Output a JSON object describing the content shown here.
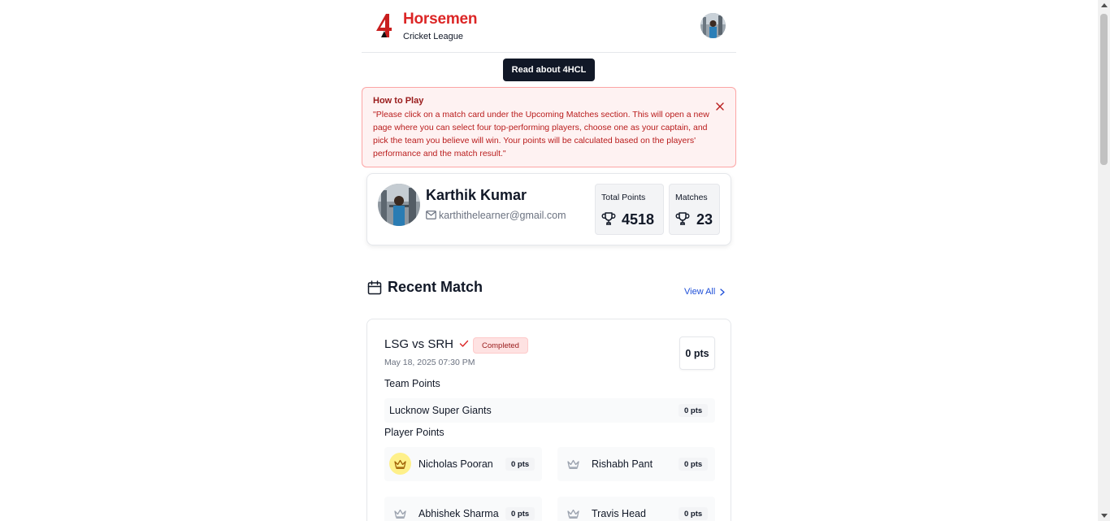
{
  "header": {
    "brand_title": "Horsemen",
    "brand_subtitle": "Cricket League",
    "logo_icon": "4-logo-icon",
    "avatar_icon": "user-avatar-icon"
  },
  "read_button": {
    "label": "Read about 4HCL"
  },
  "alert": {
    "title": "How to Play",
    "body": "\"Please click on a match card under the Upcoming Matches section. This will open a new page where you can select four top-performing players, choose one as your captain, and pick the team you believe will win. Your points will be calculated based on the players' performance and the match result.\"",
    "close_icon": "close-icon"
  },
  "profile": {
    "name": "Karthik Kumar",
    "email": "karthithelearner@gmail.com",
    "stats": [
      {
        "label": "Total Points",
        "value": "4518",
        "icon": "trophy-icon"
      },
      {
        "label": "Matches",
        "value": "23",
        "icon": "trophy-icon"
      }
    ]
  },
  "recent": {
    "title": "Recent Match",
    "view_all": "View All"
  },
  "match": {
    "title": "LSG vs SRH",
    "status": "Completed",
    "date": "May 18, 2025 07:30 PM",
    "points": "0 pts",
    "team_points_label": "Team Points",
    "team": {
      "name": "Lucknow Super Giants",
      "points": "0 pts"
    },
    "player_points_label": "Player Points",
    "players": [
      {
        "name": "Nicholas Pooran",
        "points": "0 pts",
        "captain": true
      },
      {
        "name": "Rishabh Pant",
        "points": "0 pts",
        "captain": false
      },
      {
        "name": "Abhishek Sharma",
        "points": "0 pts",
        "captain": false
      },
      {
        "name": "Travis Head",
        "points": "0 pts",
        "captain": false
      }
    ]
  },
  "colors": {
    "brand": "#dc2626",
    "dark": "#111827",
    "link": "#1d4ed8",
    "alert_bg": "#fef2f2",
    "captain_bg": "#fef08a"
  }
}
